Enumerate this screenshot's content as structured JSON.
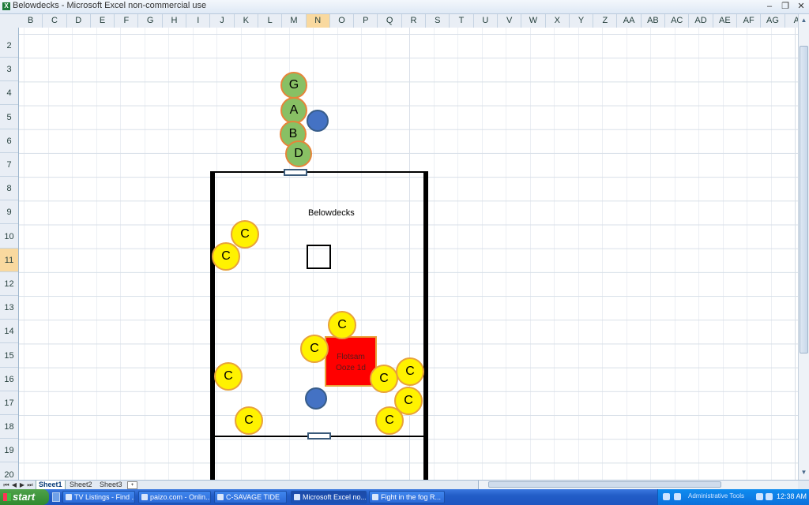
{
  "window": {
    "title": "Belowdecks - Microsoft Excel non-commercial use",
    "icon": "excel-icon",
    "minimize": "–",
    "restore": "❐",
    "close": "✕"
  },
  "columns": [
    "B",
    "C",
    "D",
    "E",
    "F",
    "G",
    "H",
    "I",
    "J",
    "K",
    "L",
    "M",
    "N",
    "O",
    "P",
    "Q",
    "R",
    "S",
    "T",
    "U",
    "V",
    "W",
    "X",
    "Y",
    "Z",
    "AA",
    "AB",
    "AC",
    "AD",
    "AE",
    "AF",
    "AG",
    "A"
  ],
  "selected_column": "N",
  "rows": [
    "2",
    "3",
    "4",
    "5",
    "6",
    "7",
    "8",
    "9",
    "10",
    "11",
    "12",
    "13",
    "14",
    "15",
    "16",
    "17",
    "18",
    "19",
    "20"
  ],
  "selected_row": "11",
  "drawing": {
    "room_label": "Belowdecks",
    "ooze_line1": "Flotsam",
    "ooze_line2": "Ooze 1d",
    "party": [
      "G",
      "A",
      "B",
      "D"
    ],
    "enemies": [
      "C",
      "C",
      "C",
      "C",
      "C",
      "C",
      "C",
      "C",
      "C",
      "C",
      "C"
    ],
    "colors": {
      "party_fill": "#88c064",
      "enemy_fill": "#fff200",
      "token_outline": "#e8a23a",
      "ally_fill": "#4472c4",
      "ooze_fill": "#ff0000"
    }
  },
  "sheet_tabs": [
    "Sheet1",
    "Sheet2",
    "Sheet3"
  ],
  "active_sheet": "Sheet1",
  "taskbar": {
    "start": "start",
    "items": [
      {
        "label": "TV Listings - Find ..."
      },
      {
        "label": "paizo.com - Onlin..."
      },
      {
        "label": "C-SAVAGE TIDE"
      },
      {
        "label": "Microsoft Excel no..."
      },
      {
        "label": "Fight in the fog R..."
      }
    ],
    "tray_label": "Administrative Tools",
    "clock": "12:38 AM"
  }
}
